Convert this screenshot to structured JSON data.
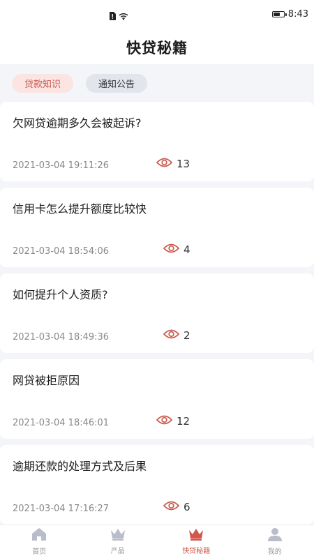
{
  "status_bar": {
    "time": "8:43"
  },
  "header": {
    "title": "快贷秘籍"
  },
  "tabs": [
    {
      "label": "贷款知识",
      "active": true
    },
    {
      "label": "通知公告",
      "active": false
    }
  ],
  "articles": [
    {
      "title": "欠网贷逾期多久会被起诉?",
      "date": "2021-03-04 19:11:26",
      "views": "13"
    },
    {
      "title": "信用卡怎么提升额度比较快",
      "date": "2021-03-04 18:54:06",
      "views": "4"
    },
    {
      "title": "如何提升个人资质?",
      "date": "2021-03-04 18:49:36",
      "views": "2"
    },
    {
      "title": "网贷被拒原因",
      "date": "2021-03-04 18:46:01",
      "views": "12"
    },
    {
      "title": "逾期还款的处理方式及后果",
      "date": "2021-03-04 17:16:27",
      "views": "6"
    }
  ],
  "bottom_nav": [
    {
      "label": "首页",
      "icon": "home-icon",
      "active": false
    },
    {
      "label": "产品",
      "icon": "crown-icon",
      "active": false
    },
    {
      "label": "快贷秘籍",
      "icon": "crown-icon",
      "active": true
    },
    {
      "label": "我的",
      "icon": "user-icon",
      "active": false
    }
  ],
  "colors": {
    "accent": "#d2564a",
    "eye_icon": "#c9594d",
    "inactive_icon": "#b8bdc9"
  }
}
